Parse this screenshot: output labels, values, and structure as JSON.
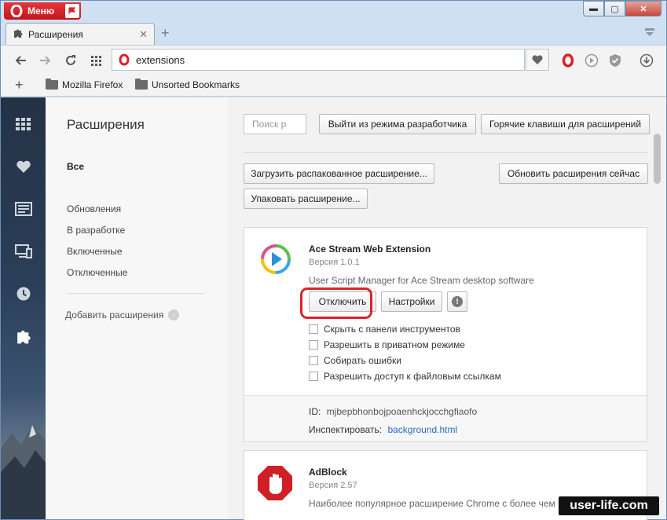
{
  "browser": {
    "menu_label": "Меню",
    "tab_title": "Расширения",
    "address": "extensions",
    "bookmarks": [
      "Mozilla Firefox",
      "Unsorted Bookmarks"
    ]
  },
  "sidebar": {
    "title": "Расширения",
    "all": "Все",
    "links": [
      "Обновления",
      "В разработке",
      "Включенные",
      "Отключенные"
    ],
    "add": "Добавить расширения"
  },
  "toolbar": {
    "search_placeholder": "Поиск р",
    "exit_dev": "Выйти из режима разработчика",
    "hotkeys": "Горячие клавиши для расширений",
    "load_unpacked": "Загрузить распакованное расширение...",
    "update_now": "Обновить расширения сейчас",
    "pack": "Упаковать расширение..."
  },
  "extensions": [
    {
      "name": "Ace Stream Web Extension",
      "version": "Версия 1.0.1",
      "description": "User Script Manager for Ace Stream desktop software",
      "disable": "Отключить",
      "settings": "Настройки",
      "options": [
        "Скрыть с панели инструментов",
        "Разрешить в приватном режиме",
        "Собирать ошибки",
        "Разрешить доступ к файловым ссылкам"
      ],
      "id_label": "ID:",
      "id_value": "mjbepbhonbojpoaenhckjocchgfiaofo",
      "inspect_label": "Инспектировать:",
      "inspect_link": "background.html"
    },
    {
      "name": "AdBlock",
      "version": "Версия 2.57",
      "description": "Наиболее популярное расширение Chrome с более чем"
    }
  ],
  "watermark": "user-life.com",
  "colors": {
    "opera_red": "#d8242a",
    "link_blue": "#2a6bc4"
  }
}
